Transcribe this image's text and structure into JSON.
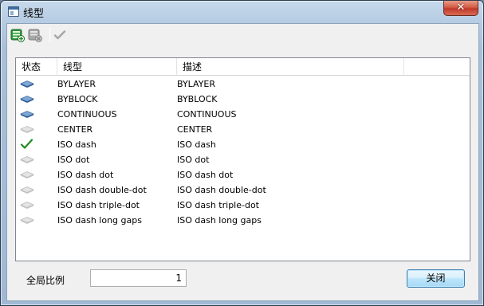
{
  "window": {
    "title": "线型",
    "close_glyph": "✕"
  },
  "toolbar": {
    "buttons": [
      {
        "icon": "add-linetype-icon",
        "enabled": true
      },
      {
        "icon": "delete-linetype-icon",
        "enabled": false
      },
      {
        "icon": "set-current-check-icon",
        "enabled": false
      }
    ]
  },
  "list": {
    "columns": [
      "状态",
      "线型",
      "描述"
    ],
    "rows": [
      {
        "status": "default",
        "name": "BYLAYER",
        "desc": "BYLAYER"
      },
      {
        "status": "default",
        "name": "BYBLOCK",
        "desc": "BYBLOCK"
      },
      {
        "status": "default",
        "name": "CONTINUOUS",
        "desc": "CONTINUOUS"
      },
      {
        "status": "loaded",
        "name": "CENTER",
        "desc": "CENTER"
      },
      {
        "status": "current",
        "name": "ISO dash",
        "desc": "ISO dash"
      },
      {
        "status": "loaded",
        "name": "ISO dot",
        "desc": "ISO dot"
      },
      {
        "status": "loaded",
        "name": "ISO dash dot",
        "desc": "ISO dash dot"
      },
      {
        "status": "loaded",
        "name": "ISO dash double-dot",
        "desc": "ISO dash double-dot"
      },
      {
        "status": "loaded",
        "name": "ISO dash triple-dot",
        "desc": "ISO dash triple-dot"
      },
      {
        "status": "loaded",
        "name": "ISO dash long gaps",
        "desc": "ISO dash long gaps"
      }
    ]
  },
  "footer": {
    "scale_label": "全局比例",
    "scale_value": "1",
    "close_label": "关闭"
  },
  "colors": {
    "accent": "#3c7fb1",
    "check": "#1f8a1f",
    "title_bg": "#b5cbe2"
  }
}
